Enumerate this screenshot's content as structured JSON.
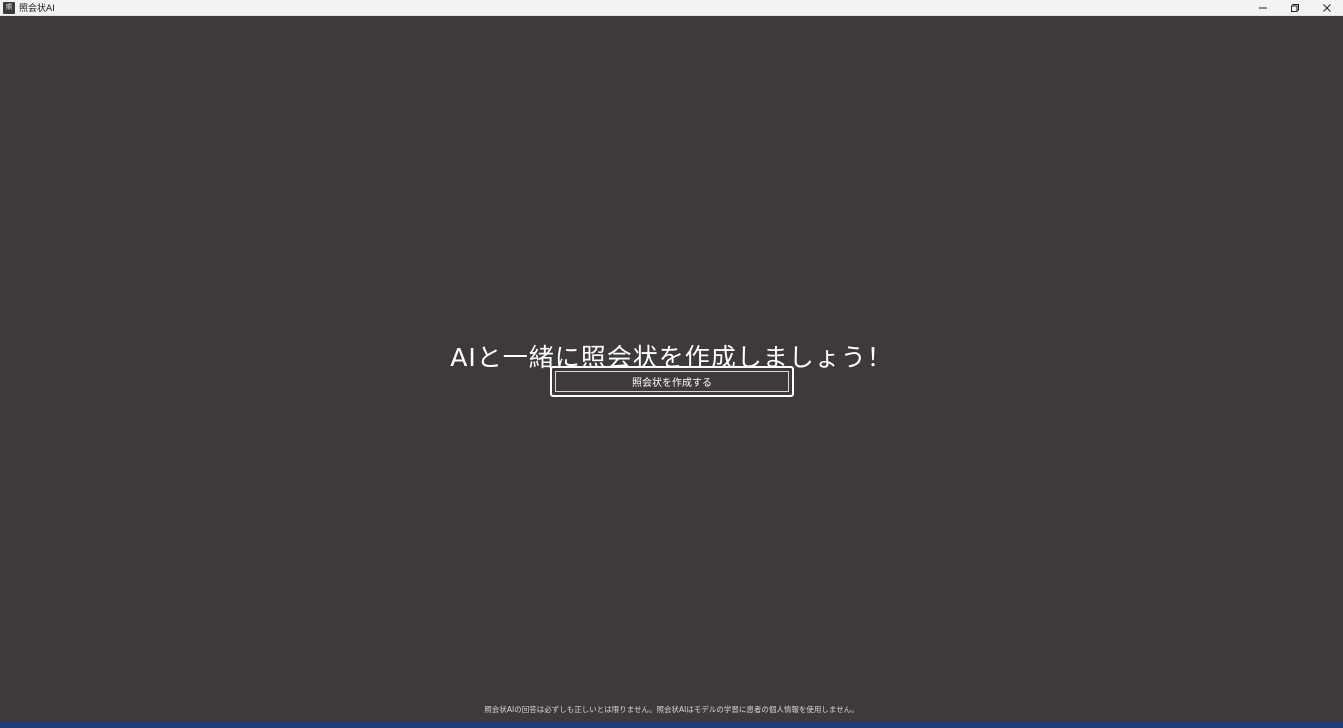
{
  "window": {
    "title": "照会状AI",
    "app_icon_text": "照",
    "controls": {
      "minimize": "minimize-icon",
      "restore": "restore-icon",
      "close": "close-icon"
    }
  },
  "main": {
    "headline": "AIと一緒に照会状を作成しましょう！",
    "create_button_label": "照会状を作成する",
    "disclaimer": "照会状AIの回答は必ずしも正しいとは限りません。照会状AIはモデルの学習に患者の個人情報を使用しません。"
  },
  "colors": {
    "background": "#3d3a39",
    "text": "#ffffff",
    "titlebar": "#f3f3f3"
  }
}
